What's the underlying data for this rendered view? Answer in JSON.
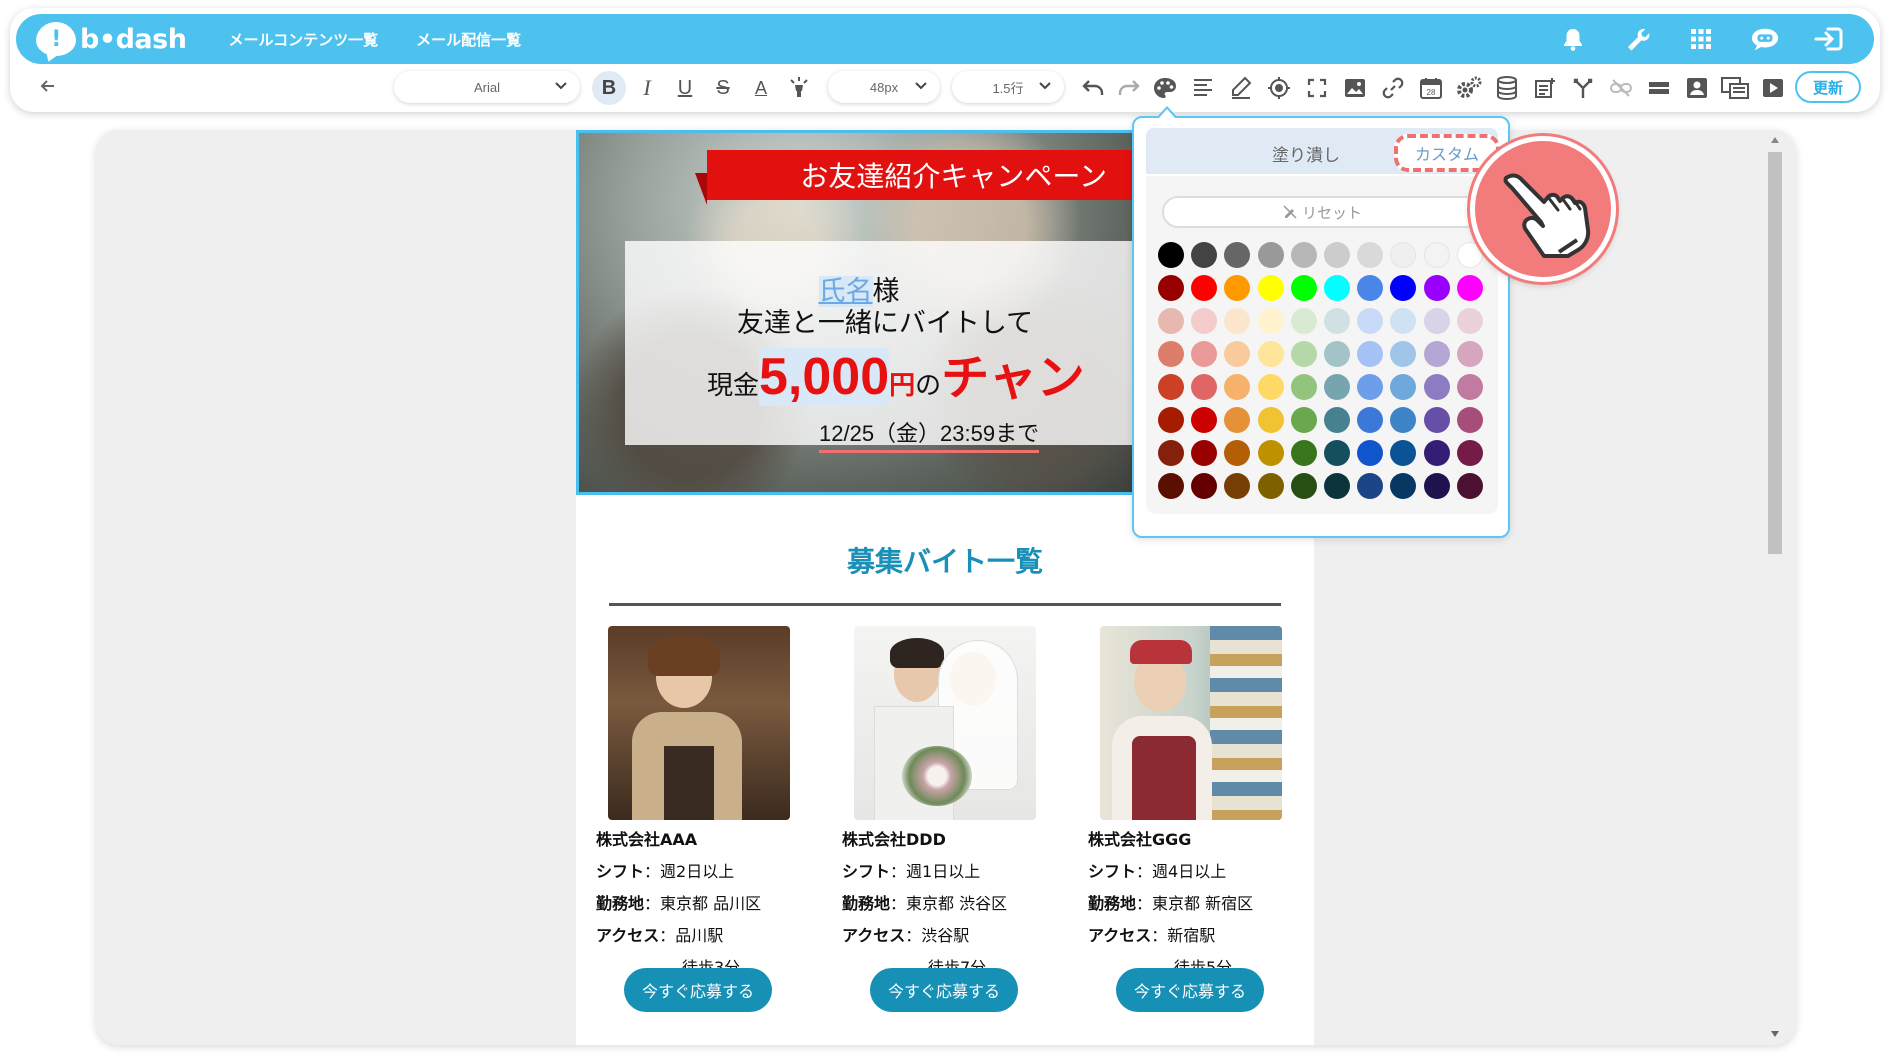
{
  "app": {
    "logo_text": "b•dash",
    "nav": [
      "メールコンテンツ一覧",
      "メール配信一覧"
    ],
    "top_icons": [
      "bell-icon",
      "wrench-icon",
      "grid-icon",
      "chat-bot-icon",
      "logout-icon"
    ]
  },
  "toolbar": {
    "font_family": "Arial",
    "font_size": "48px",
    "line_height": "1.5行",
    "bold": "B",
    "italic": "I",
    "underline": "U",
    "strike": "S",
    "font_color": "A",
    "update_label": "更新",
    "icons": [
      "undo-icon",
      "redo-icon",
      "palette-icon",
      "align-icon",
      "pen-icon",
      "target-icon",
      "fullscreen-icon",
      "image-icon",
      "link-icon",
      "calendar-icon",
      "settings-icon",
      "database-icon",
      "note-icon",
      "branch-icon",
      "link-off-icon",
      "divider-icon",
      "contact-icon",
      "template-icon",
      "video-icon"
    ]
  },
  "hero": {
    "banner": "お友達紹介キャンペーン",
    "name_placeholder": "氏名",
    "name_suffix": "様",
    "line2": "友達と一緒にバイトして",
    "cash_prefix": "現金",
    "amount": "5,000",
    "yen": "円",
    "no": "の",
    "chance": "チャン",
    "deadline": "12/25（金）23:59まで"
  },
  "section": {
    "title": "募集バイト一覧"
  },
  "cards": [
    {
      "company": "株式会社AAA",
      "shift_label": "シフト",
      "shift": "：週2日以上",
      "place_label": "勤務地",
      "place": "：東京都 品川区",
      "access_label": "アクセス",
      "access": "：品川駅",
      "walk": "徒歩3分",
      "apply": "今すぐ応募する"
    },
    {
      "company": "株式会社DDD",
      "shift_label": "シフト",
      "shift": "：週1日以上",
      "place_label": "勤務地",
      "place": "：東京都 渋谷区",
      "access_label": "アクセス",
      "access": "：渋谷駅",
      "walk": "徒歩7分",
      "apply": "今すぐ応募する"
    },
    {
      "company": "株式会社GGG",
      "shift_label": "シフト",
      "shift": "：週4日以上",
      "place_label": "勤務地",
      "place": "：東京都 新宿区",
      "access_label": "アクセス",
      "access": "：新宿駅",
      "walk": "徒歩5分",
      "apply": "今すぐ応募する"
    }
  ],
  "color_popover": {
    "tab_fill": "塗り潰し",
    "tab_custom": "カスタム",
    "reset": "リセット",
    "swatches": [
      "#000000",
      "#434343",
      "#666666",
      "#999999",
      "#b7b7b7",
      "#cccccc",
      "#d9d9d9",
      "#efefef",
      "#f3f3f3",
      "#ffffff",
      "#980000",
      "#ff0000",
      "#ff9900",
      "#ffff00",
      "#00ff00",
      "#00ffff",
      "#4a86e8",
      "#0000ff",
      "#9900ff",
      "#ff00ff",
      "#e6b8af",
      "#f4cccc",
      "#fce5cd",
      "#fff2cc",
      "#d9ead3",
      "#d0e0e3",
      "#c9daf8",
      "#cfe2f3",
      "#d9d2e9",
      "#ead1dc",
      "#dd7e6b",
      "#ea9999",
      "#f9cb9c",
      "#ffe599",
      "#b6d7a8",
      "#a2c4c9",
      "#a4c2f4",
      "#9fc5e8",
      "#b4a7d6",
      "#d5a6bd",
      "#cc4125",
      "#e06666",
      "#f6b26b",
      "#ffd966",
      "#93c47d",
      "#76a5af",
      "#6d9eeb",
      "#6fa8dc",
      "#8e7cc3",
      "#c27ba0",
      "#a61c00",
      "#cc0000",
      "#e69138",
      "#f1c232",
      "#6aa84f",
      "#45818e",
      "#3c78d8",
      "#3d85c6",
      "#674ea7",
      "#a64d79",
      "#85200c",
      "#990000",
      "#b45f06",
      "#bf9000",
      "#38761d",
      "#134f5c",
      "#1155cc",
      "#0b5394",
      "#351c75",
      "#741b47",
      "#5b0f00",
      "#660000",
      "#783f04",
      "#7f6000",
      "#274e13",
      "#0c343d",
      "#1c4587",
      "#073763",
      "#20124d",
      "#4c1130"
    ]
  }
}
